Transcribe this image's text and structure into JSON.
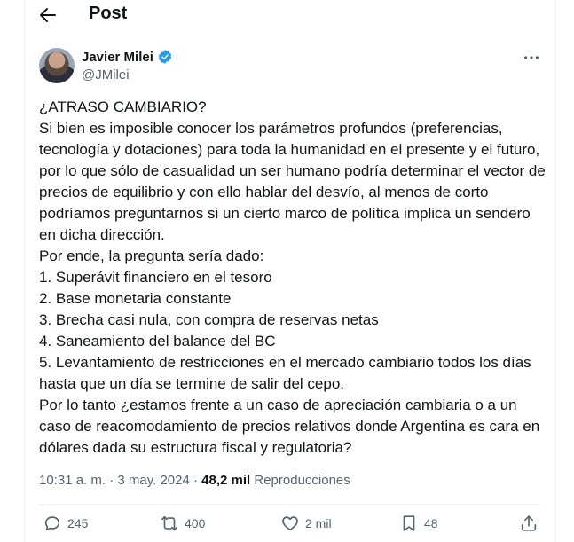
{
  "header": {
    "title": "Post"
  },
  "author": {
    "name": "Javier Milei",
    "handle": "@JMilei"
  },
  "tweet": {
    "text": "¿ATRASO CAMBIARIO?\nSi bien es imposible conocer los parámetros profundos (preferencias, tecnología y dotaciones) para toda la humanidad en el presente y el futuro, por lo que sólo de casualidad un ser humano podría determinar el vector de precios de equilibrio y con ello hablar del desvío, al menos de corto podríamos preguntarnos si un cierto marco de política implica un sendero en dicha dirección.\nPor ende, la pregunta sería dado:\n1. Superávit financiero en el tesoro\n2. Base monetaria constante\n3. Brecha casi nula, con compra de reservas netas\n4. Saneamiento del balance del BC\n5. Levantamiento de restricciones en el mercado cambiario todos los días hasta que un día se termine de salir del cepo.\nPor lo tanto ¿estamos frente a un caso de apreciación cambiaria o a un caso de reacomodamiento de precios relativos donde Argentina es cara en dólares dada su estructura fiscal y regulatoria?"
  },
  "meta": {
    "timestamp": "10:31 a. m. · 3 may. 2024",
    "separator": " · ",
    "views_count": "48,2 mil",
    "views_label": "Reproducciones"
  },
  "actions": {
    "replies": "245",
    "reposts": "400",
    "likes": "2 mil",
    "bookmarks": "48"
  },
  "icons": {
    "back": "arrow-left-icon",
    "verified": "verified-badge-icon",
    "more": "more-dots-icon",
    "reply": "reply-bubble-icon",
    "repost": "repost-icon",
    "like": "heart-icon",
    "bookmark": "bookmark-icon",
    "share": "share-icon"
  },
  "colors": {
    "verified": "#1d9bf0",
    "text": "#0f1419",
    "secondary": "#536471"
  }
}
